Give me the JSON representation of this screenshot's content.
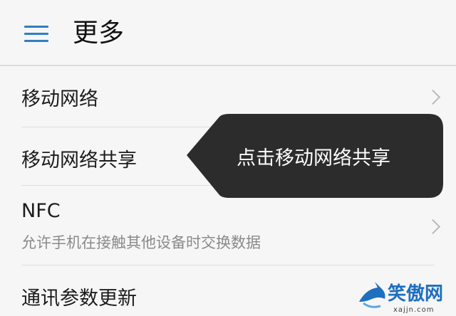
{
  "header": {
    "title": "更多",
    "menu_icon": "hamburger-menu-icon",
    "accent": "#2f7fc1"
  },
  "settings": [
    {
      "title": "移动网络"
    },
    {
      "title": "移动网络共享"
    },
    {
      "title": "NFC",
      "subtitle": "允许手机在接触其他设备时交换数据"
    },
    {
      "title": "通讯参数更新"
    }
  ],
  "tooltip": {
    "text": "点击移动网络共享",
    "background": "#2c2c2c"
  },
  "watermark": {
    "name": "笑傲网",
    "url": "xajjn.com",
    "logo_icon": "shark-logo-icon"
  }
}
